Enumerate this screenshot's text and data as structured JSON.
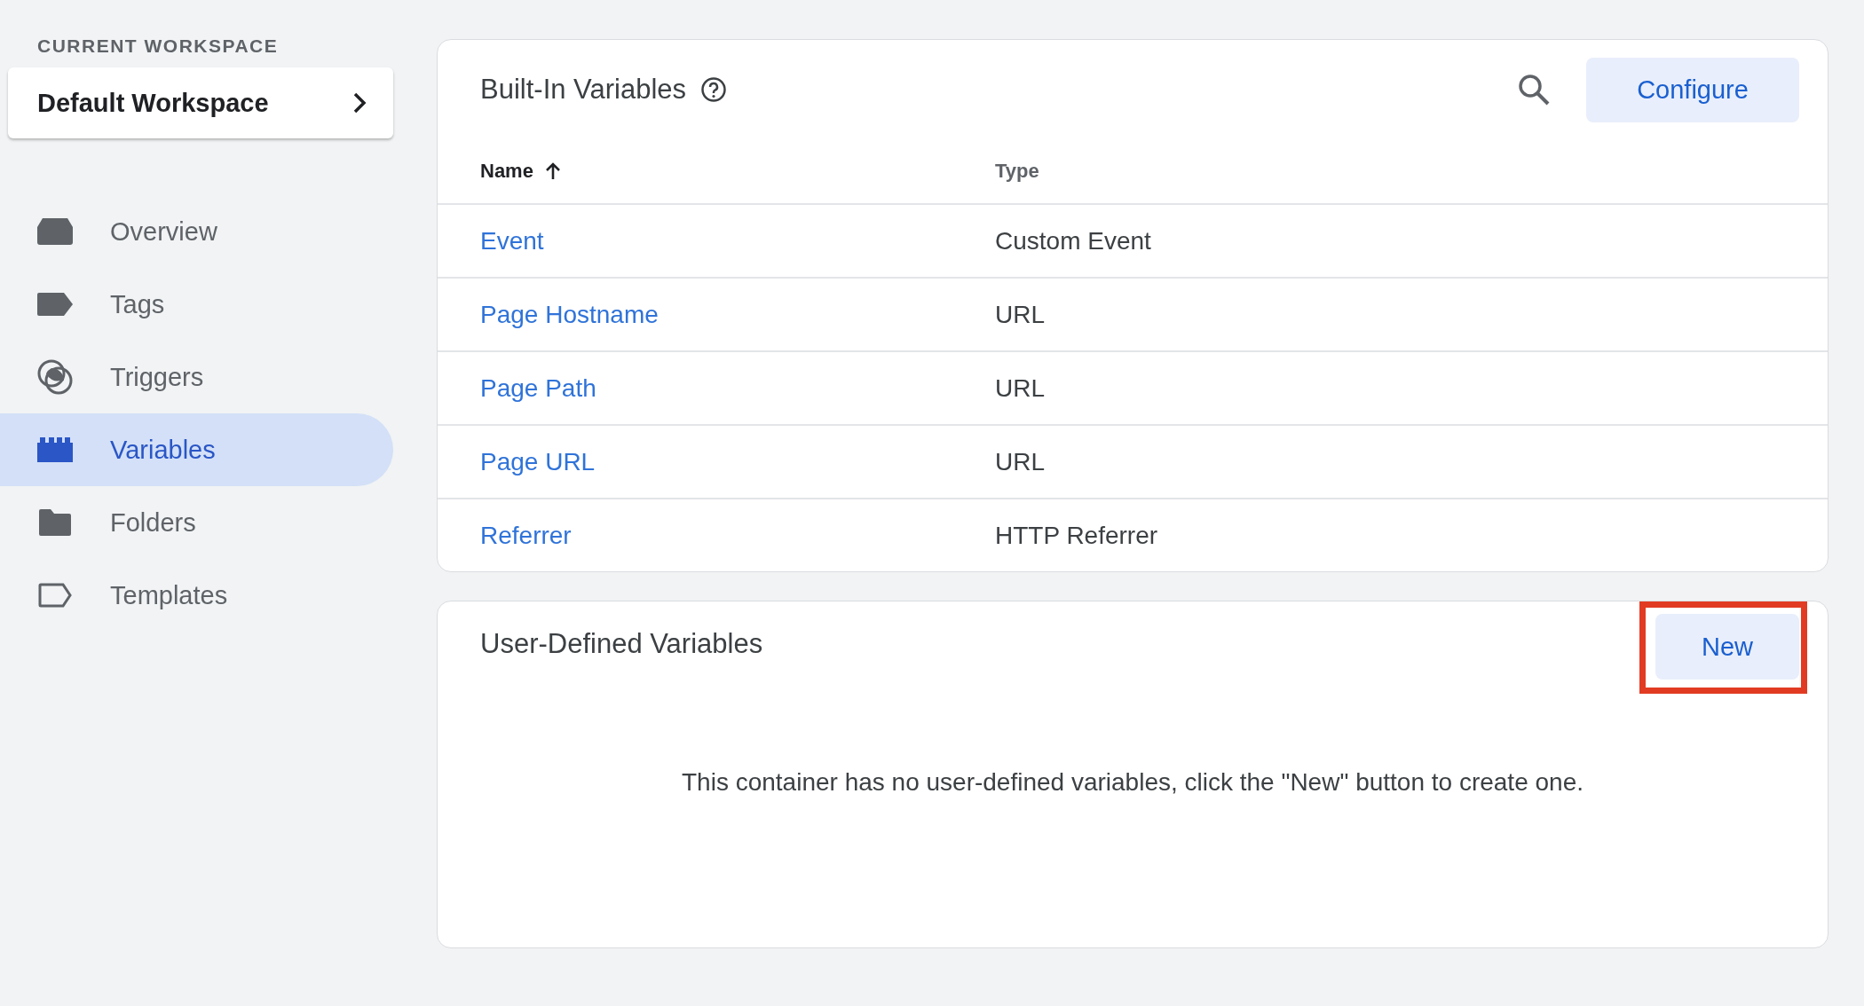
{
  "sidebar": {
    "workspace_heading": "CURRENT WORKSPACE",
    "workspace": "Default Workspace",
    "items": [
      {
        "label": "Overview",
        "kind": "overview",
        "selected": false
      },
      {
        "label": "Tags",
        "kind": "tag",
        "selected": false
      },
      {
        "label": "Triggers",
        "kind": "trigger",
        "selected": false
      },
      {
        "label": "Variables",
        "kind": "variable",
        "selected": true
      },
      {
        "label": "Folders",
        "kind": "folder",
        "selected": false
      },
      {
        "label": "Templates",
        "kind": "template",
        "selected": false
      }
    ]
  },
  "built_in": {
    "title": "Built-In Variables",
    "configure_button": "Configure",
    "columns": [
      {
        "label": "Name",
        "sort_ascending": true
      },
      {
        "label": "Type"
      }
    ],
    "rows": [
      {
        "name": "Event",
        "type": "Custom Event"
      },
      {
        "name": "Page Hostname",
        "type": "URL"
      },
      {
        "name": "Page Path",
        "type": "URL"
      },
      {
        "name": "Page URL",
        "type": "URL"
      },
      {
        "name": "Referrer",
        "type": "HTTP Referrer"
      }
    ]
  },
  "user_defined": {
    "title": "User-Defined Variables",
    "new_button": {
      "label": "New",
      "highlighted": true
    },
    "empty_message": "This container has no user-defined variables, click the \"New\" button to create one."
  }
}
